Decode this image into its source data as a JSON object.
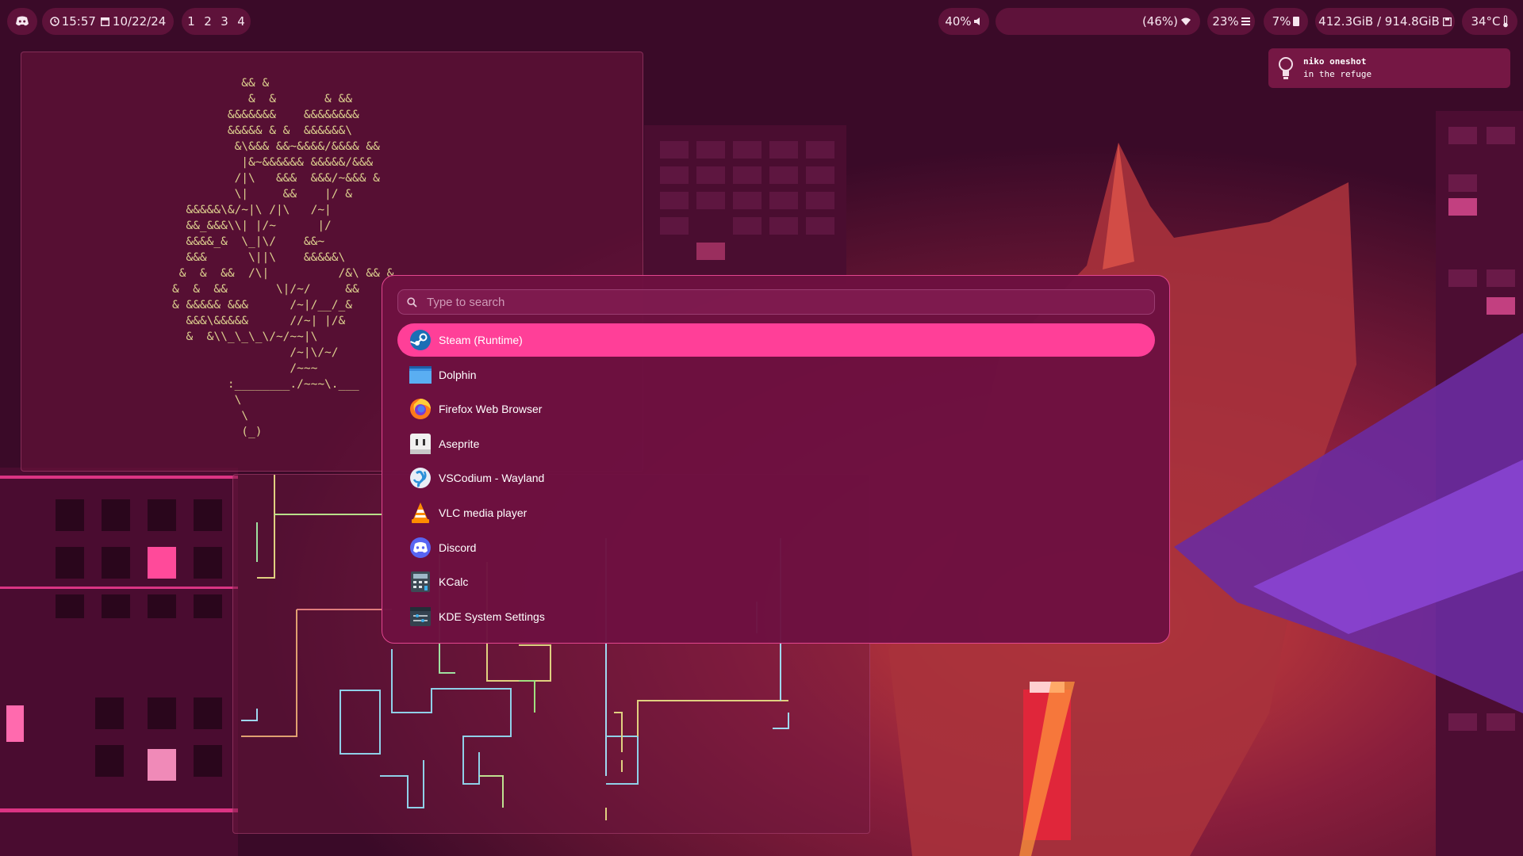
{
  "topbar": {
    "clock": "15:57",
    "date": "10/22/24",
    "workspaces": [
      "1",
      "2",
      "3",
      "4"
    ],
    "volume": "40%",
    "network": "(46%)",
    "cpu": "23%",
    "memory": "7%",
    "disk": "412.3GiB / 914.8GiB",
    "temperature": "34°C"
  },
  "notification": {
    "title": "niko oneshot",
    "body": "in the refuge"
  },
  "launcher": {
    "search_placeholder": "Type to search",
    "apps": [
      {
        "name": "Steam (Runtime)",
        "icon": "steam-icon",
        "selected": true
      },
      {
        "name": "Dolphin",
        "icon": "folder-icon",
        "selected": false
      },
      {
        "name": "Firefox Web Browser",
        "icon": "firefox-icon",
        "selected": false
      },
      {
        "name": "Aseprite",
        "icon": "aseprite-icon",
        "selected": false
      },
      {
        "name": "VSCodium - Wayland",
        "icon": "vscodium-icon",
        "selected": false
      },
      {
        "name": "VLC media player",
        "icon": "vlc-icon",
        "selected": false
      },
      {
        "name": "Discord",
        "icon": "discord-icon",
        "selected": false
      },
      {
        "name": "KCalc",
        "icon": "calculator-icon",
        "selected": false
      },
      {
        "name": "KDE System Settings",
        "icon": "settings-icon",
        "selected": false
      }
    ]
  },
  "terminal": {
    "ascii_art": "          && &\n           &  &       & &&\n        &&&&&&&    &&&&&&&&\n        &&&&& & &  &&&&&&\\\n         &\\&&& &&~&&&&/&&&& &&\n          |&~&&&&&& &&&&&/&&&\n         /|\\   &&&  &&&/~&&& &\n         \\|     &&    |/ &\n  &&&&&\\&/~|\\ /|\\   /~|\n  &&_&&&\\\\| |/~      |/\n  &&&&_&  \\_|\\/    &&~\n  &&&      \\||\\    &&&&&\\\n &  &  &&  /\\|          /&\\ && &\n&  &  &&       \\|/~/     &&\n& &&&&& &&&      /~|/__/_&\n  &&&\\&&&&&      //~| |/&\n  &  &\\\\_\\_\\_\\/~/~~|\\\n                 /~|\\/~/\n                 /~~~\n        :________./~~~\\.___\n         \\\n          \\\n          (_)",
    "colors": {
      "text": "#dccf8e"
    }
  },
  "colors": {
    "accent": "#ff3f98",
    "panel": "#6d1140",
    "border": "#e2468f",
    "topbar_pill": "#62143c"
  }
}
